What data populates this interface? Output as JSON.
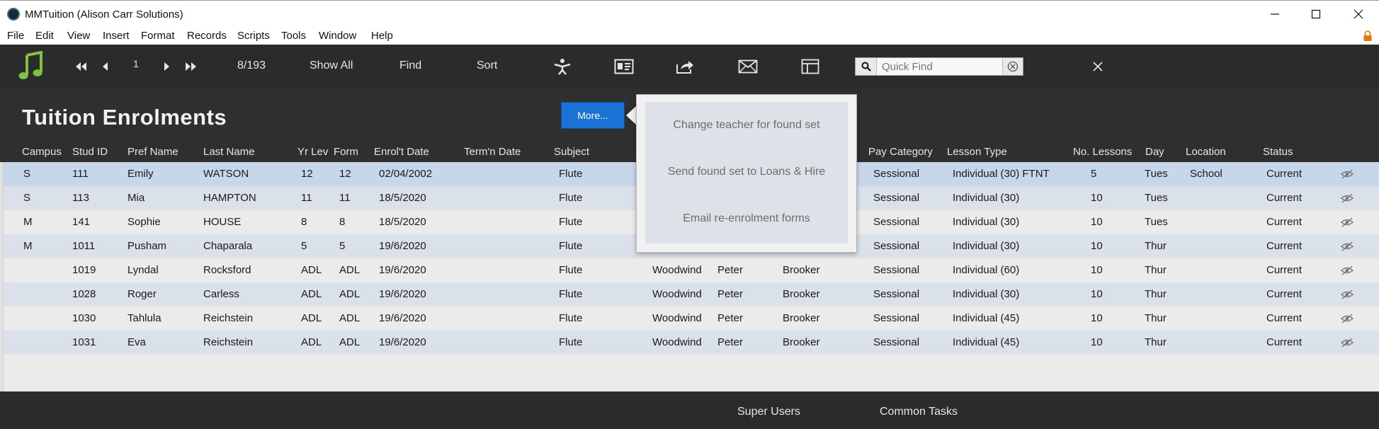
{
  "window": {
    "title": "MMTuition (Alison Carr Solutions)"
  },
  "menu": [
    "File",
    "Edit",
    "View",
    "Insert",
    "Format",
    "Records",
    "Scripts",
    "Tools",
    "Window",
    "Help"
  ],
  "toolbar": {
    "record_number": "1",
    "record_count": "8/193",
    "show_all": "Show All",
    "find": "Find",
    "sort": "Sort",
    "quick_find_placeholder": "Quick Find"
  },
  "page": {
    "title": "Tuition Enrolments",
    "more_button": "More..."
  },
  "popover": {
    "items": [
      "Change teacher for found set",
      "Send found set to Loans & Hire",
      "Email re-enrolment forms"
    ]
  },
  "columns": [
    "Campus",
    "Stud ID",
    "Pref Name",
    "Last Name",
    "Yr Lev",
    "Form",
    "Enrol't Date",
    "Term'n Date",
    "Subject",
    "Pay Category",
    "Lesson Type",
    "No. Lessons",
    "Day",
    "Location",
    "Status"
  ],
  "rows": [
    {
      "campus": "S",
      "stud_id": "111",
      "pref_name": "Emily",
      "last_name": "WATSON",
      "yr_lev": "12",
      "form": "12",
      "enrol_date": "02/04/2002",
      "term_date": "",
      "subject": "Flute",
      "dept": "",
      "teacher_first": "",
      "teacher_last": "",
      "pay_category": "Sessional",
      "lesson_type": "Individual (30) FTNT",
      "no_lessons": "5",
      "day": "Tues",
      "location": "School",
      "status": "Current"
    },
    {
      "campus": "S",
      "stud_id": "113",
      "pref_name": "Mia",
      "last_name": "HAMPTON",
      "yr_lev": "11",
      "form": "11",
      "enrol_date": "18/5/2020",
      "term_date": "",
      "subject": "Flute",
      "dept": "",
      "teacher_first": "",
      "teacher_last": "",
      "pay_category": "Sessional",
      "lesson_type": "Individual (30)",
      "no_lessons": "10",
      "day": "Tues",
      "location": "",
      "status": "Current"
    },
    {
      "campus": "M",
      "stud_id": "141",
      "pref_name": "Sophie",
      "last_name": "HOUSE",
      "yr_lev": "8",
      "form": "8",
      "enrol_date": "18/5/2020",
      "term_date": "",
      "subject": "Flute",
      "dept": "",
      "teacher_first": "",
      "teacher_last": "",
      "pay_category": "Sessional",
      "lesson_type": "Individual (30)",
      "no_lessons": "10",
      "day": "Tues",
      "location": "",
      "status": "Current"
    },
    {
      "campus": "M",
      "stud_id": "1011",
      "pref_name": "Pusham",
      "last_name": "Chaparala",
      "yr_lev": "5",
      "form": "5",
      "enrol_date": "19/6/2020",
      "term_date": "",
      "subject": "Flute",
      "dept": "",
      "teacher_first": "",
      "teacher_last": "",
      "pay_category": "Sessional",
      "lesson_type": "Individual (30)",
      "no_lessons": "10",
      "day": "Thur",
      "location": "",
      "status": "Current"
    },
    {
      "campus": "",
      "stud_id": "1019",
      "pref_name": "Lyndal",
      "last_name": "Rocksford",
      "yr_lev": "ADL",
      "form": "ADL",
      "enrol_date": "19/6/2020",
      "term_date": "",
      "subject": "Flute",
      "dept": "Woodwind",
      "teacher_first": "Peter",
      "teacher_last": "Brooker",
      "pay_category": "Sessional",
      "lesson_type": "Individual (60)",
      "no_lessons": "10",
      "day": "Thur",
      "location": "",
      "status": "Current"
    },
    {
      "campus": "",
      "stud_id": "1028",
      "pref_name": "Roger",
      "last_name": "Carless",
      "yr_lev": "ADL",
      "form": "ADL",
      "enrol_date": "19/6/2020",
      "term_date": "",
      "subject": "Flute",
      "dept": "Woodwind",
      "teacher_first": "Peter",
      "teacher_last": "Brooker",
      "pay_category": "Sessional",
      "lesson_type": "Individual (30)",
      "no_lessons": "10",
      "day": "Thur",
      "location": "",
      "status": "Current"
    },
    {
      "campus": "",
      "stud_id": "1030",
      "pref_name": "Tahlula",
      "last_name": "Reichstein",
      "yr_lev": "ADL",
      "form": "ADL",
      "enrol_date": "19/6/2020",
      "term_date": "",
      "subject": "Flute",
      "dept": "Woodwind",
      "teacher_first": "Peter",
      "teacher_last": "Brooker",
      "pay_category": "Sessional",
      "lesson_type": "Individual (45)",
      "no_lessons": "10",
      "day": "Thur",
      "location": "",
      "status": "Current"
    },
    {
      "campus": "",
      "stud_id": "1031",
      "pref_name": "Eva",
      "last_name": "Reichstein",
      "yr_lev": "ADL",
      "form": "ADL",
      "enrol_date": "19/6/2020",
      "term_date": "",
      "subject": "Flute",
      "dept": "Woodwind",
      "teacher_first": "Peter",
      "teacher_last": "Brooker",
      "pay_category": "Sessional",
      "lesson_type": "Individual (45)",
      "no_lessons": "10",
      "day": "Thur",
      "location": "",
      "status": "Current"
    }
  ],
  "footer": {
    "super_users": "Super Users",
    "common_tasks": "Common Tasks"
  },
  "icons": {
    "app": "app-logo-icon",
    "music": "music-note-icon",
    "first": "first-record-icon",
    "prev": "previous-record-icon",
    "next": "next-record-icon",
    "last": "last-record-icon",
    "person": "person-icon",
    "card": "contact-card-icon",
    "share": "share-icon",
    "email": "email-icon",
    "layout": "table-layout-icon",
    "search": "search-icon",
    "clear": "clear-icon",
    "close": "close-icon",
    "eye": "eye-hidden-icon",
    "lock": "lock-icon"
  },
  "colors": {
    "accent": "#1a73d4",
    "music_icon": "#7dc244",
    "selected_row": "#c7d7ea",
    "alt_row": "#dbe1ea",
    "toolbar_bg": "#2b2b2b",
    "lock": "#e07b00"
  }
}
